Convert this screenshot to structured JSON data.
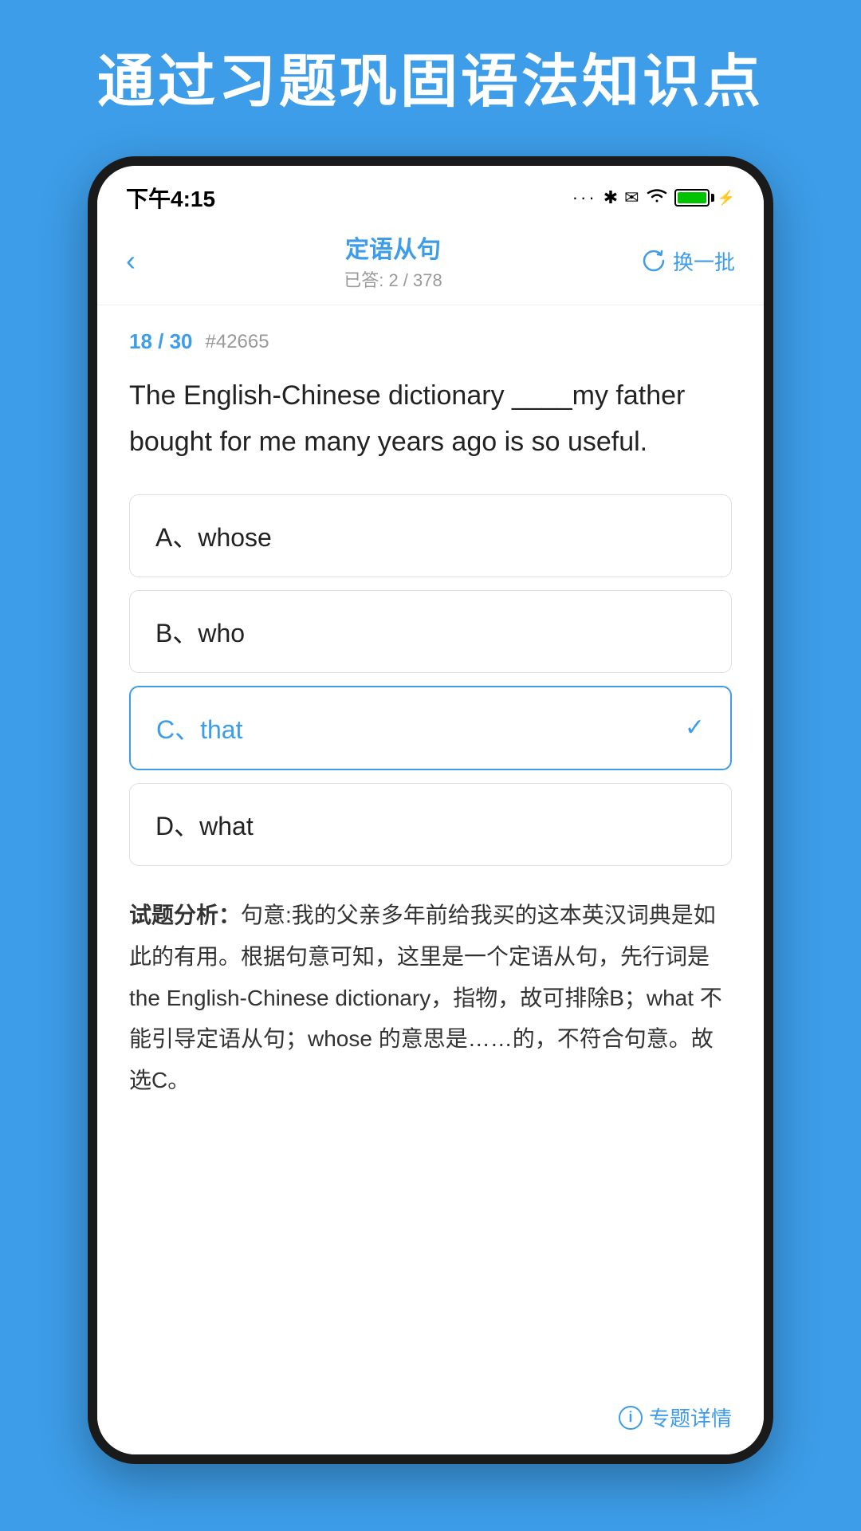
{
  "page": {
    "background_color": "#3d9de8",
    "title": "通过习题巩固语法知识点"
  },
  "status_bar": {
    "time": "下午4:15",
    "battery_percent": "100"
  },
  "nav": {
    "back_label": "‹",
    "title": "定语从句",
    "subtitle": "已答: 2 / 378",
    "action_label": "换一批"
  },
  "question": {
    "progress": "18 / 30",
    "id": "#42665",
    "text": "The English-Chinese dictionary ____my father bought for me many years ago is so useful.",
    "options": [
      {
        "id": "A",
        "separator": "、",
        "text": "whose",
        "selected": false,
        "correct": false
      },
      {
        "id": "B",
        "separator": "、",
        "text": "who",
        "selected": false,
        "correct": false
      },
      {
        "id": "C",
        "separator": "、",
        "text": "that",
        "selected": true,
        "correct": true
      },
      {
        "id": "D",
        "separator": "、",
        "text": "what",
        "selected": false,
        "correct": false
      }
    ],
    "analysis_label": "试题分析：",
    "analysis_text": "句意:我的父亲多年前给我买的这本英汉词典是如此的有用。根据句意可知，这里是一个定语从句，先行词是the English-Chinese dictionary，指物，故可排除B；what 不能引导定语从句；whose 的意思是……的，不符合句意。故选C。"
  },
  "bottom": {
    "detail_label": "专题详情"
  }
}
